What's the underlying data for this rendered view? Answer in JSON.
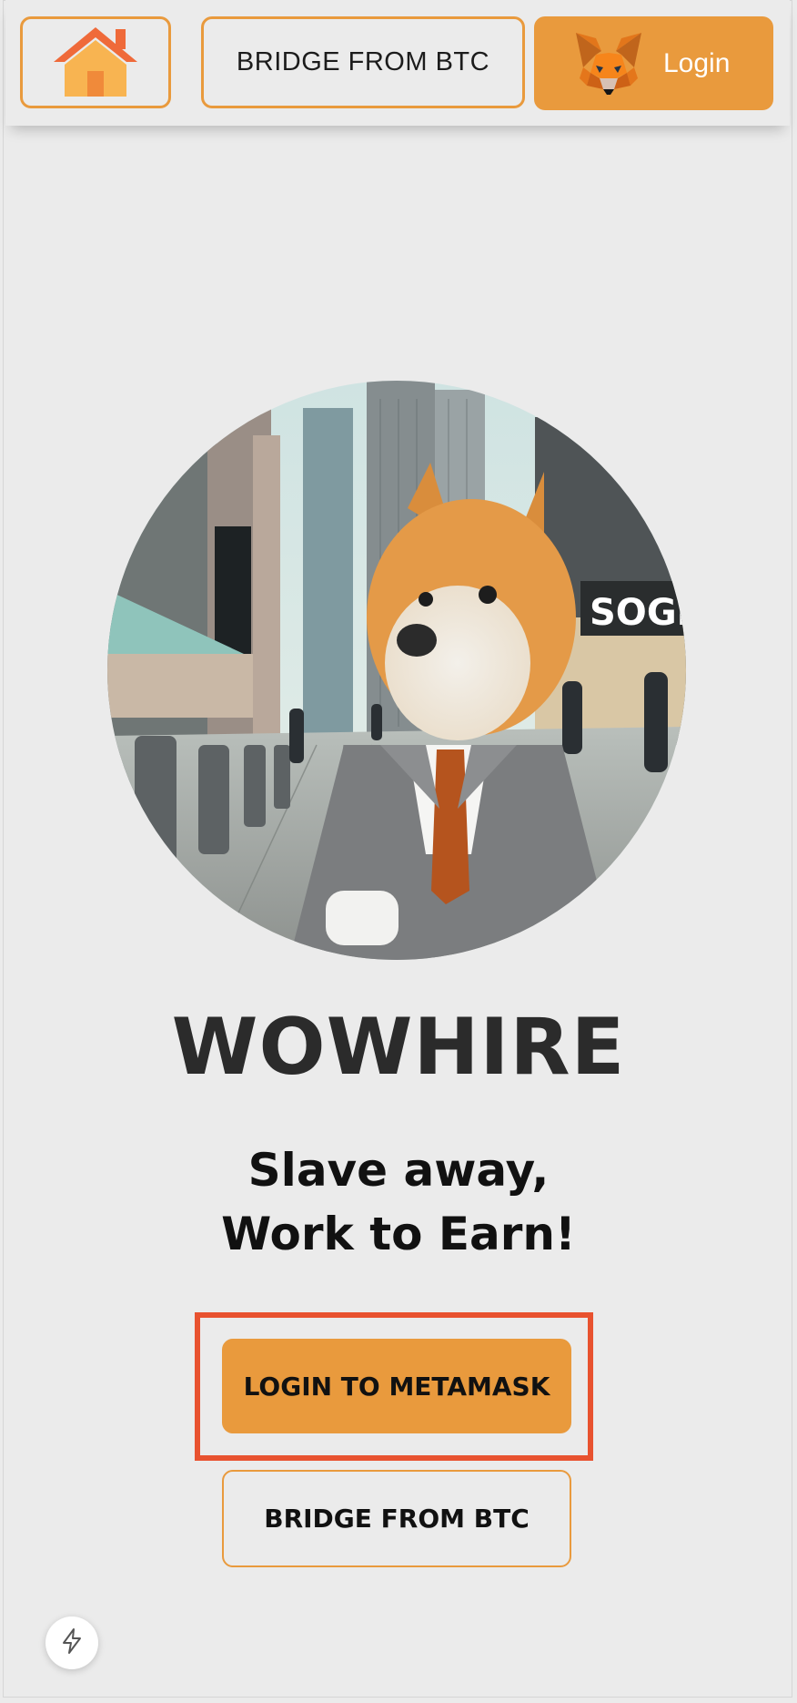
{
  "header": {
    "home_icon": "house-icon",
    "bridge_label": "BRIDGE FROM BTC",
    "login_label": "Login",
    "login_icon": "metamask-fox-icon"
  },
  "hero": {
    "image": "shiba-in-suit-city-street",
    "shop_sign": "SOGE"
  },
  "main": {
    "title": "WOWHIRE",
    "tagline_line1": "Slave away,",
    "tagline_line2": "Work to Earn!",
    "login_button": "LOGIN TO METAMASK",
    "bridge_button": "BRIDGE FROM BTC"
  },
  "floating": {
    "icon": "lightning-icon"
  },
  "colors": {
    "accent": "#e99a3d",
    "highlight": "#e8522f",
    "background": "#ebebeb"
  }
}
